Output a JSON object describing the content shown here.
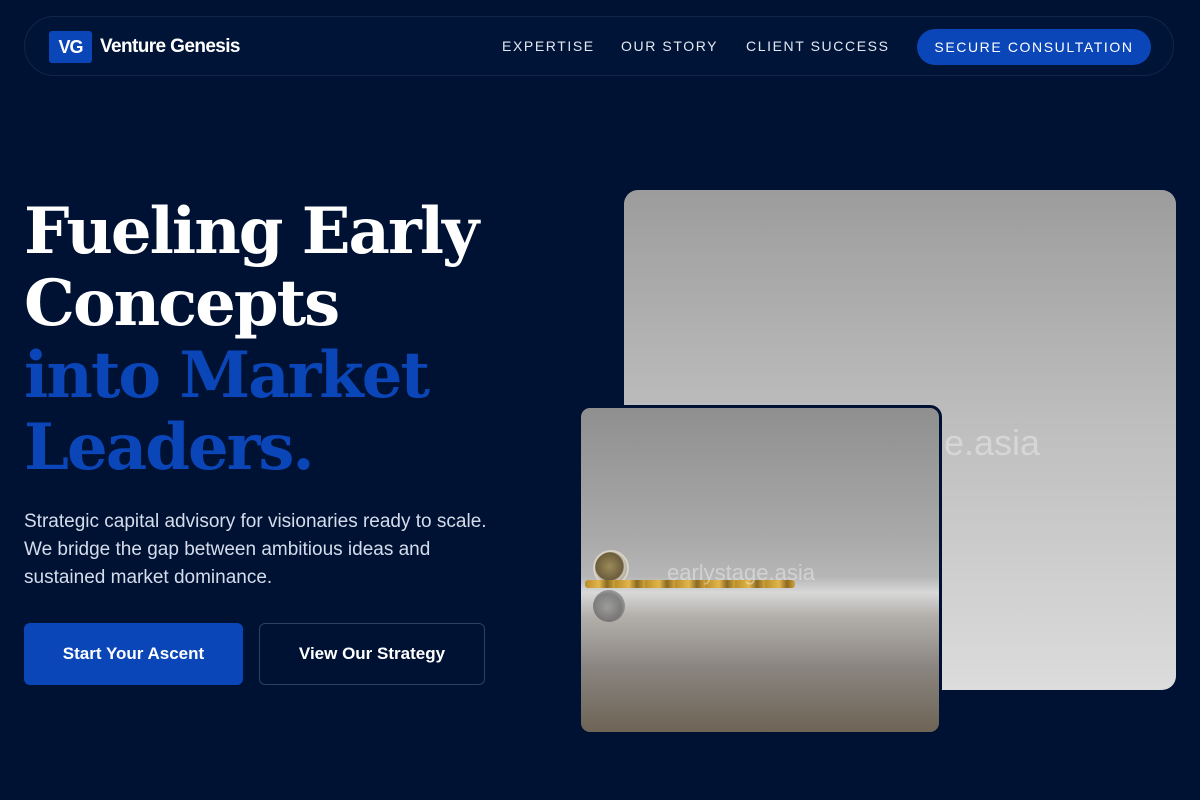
{
  "brand": {
    "mark": "VG",
    "name": "Venture Genesis"
  },
  "nav": {
    "links": [
      "EXPERTISE",
      "OUR STORY",
      "CLIENT SUCCESS"
    ],
    "cta": "SECURE CONSULTATION"
  },
  "hero": {
    "headline_line1": "Fueling Early",
    "headline_line2": "Concepts",
    "headline_line3": "into Market",
    "headline_line4": "Leaders.",
    "subtext": "Strategic capital advisory for visionaries ready to scale. We bridge the gap between ambitious ideas and sustained market dominance.",
    "primary_button": "Start Your Ascent",
    "secondary_button": "View Our Strategy"
  },
  "images": {
    "large_watermark": "e.asia",
    "small_watermark": "earlystage.asia"
  },
  "colors": {
    "background": "#001233",
    "accent": "#0a46b8",
    "text": "#ffffff"
  }
}
